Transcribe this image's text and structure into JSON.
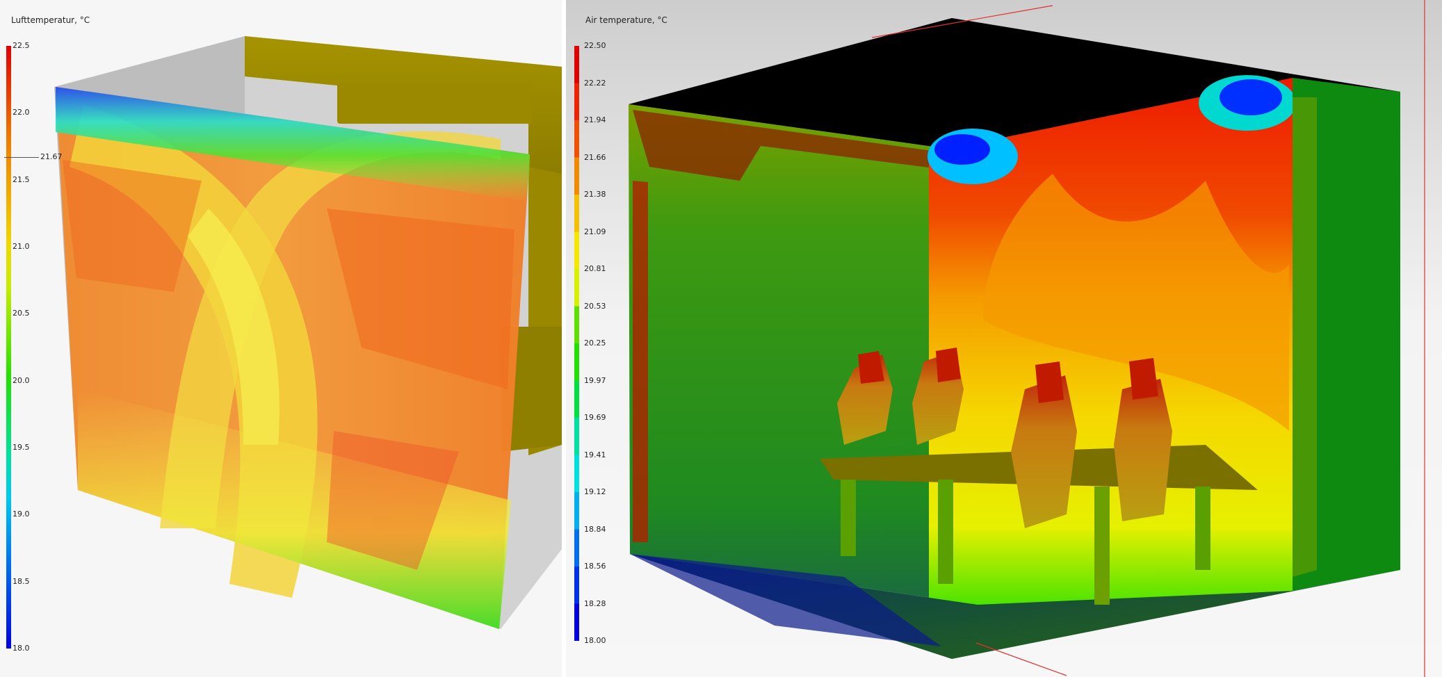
{
  "left_panel": {
    "title": "Lufttemperatur, °C",
    "colorbar": {
      "ticks": [
        "22.5",
        "22.0",
        "21.5",
        "21.0",
        "20.5",
        "20.0",
        "19.5",
        "19.0",
        "18.5",
        "18.0"
      ],
      "marker": "21.67",
      "min": 18.0,
      "max": 22.5
    }
  },
  "right_panel": {
    "title": "Air temperature, °C",
    "colorbar": {
      "ticks": [
        "22.50",
        "22.22",
        "21.94",
        "21.66",
        "21.38",
        "21.09",
        "20.81",
        "20.53",
        "20.25",
        "19.97",
        "19.69",
        "19.41",
        "19.12",
        "18.84",
        "18.56",
        "18.28",
        "18.00"
      ],
      "min": 18.0,
      "max": 22.5
    }
  },
  "colors": {
    "hot": "#e00000",
    "warm": "#f28c00",
    "mid": "#f5e800",
    "cool": "#22e000",
    "cold": "#0000e0",
    "floor": "#0b3d18"
  }
}
